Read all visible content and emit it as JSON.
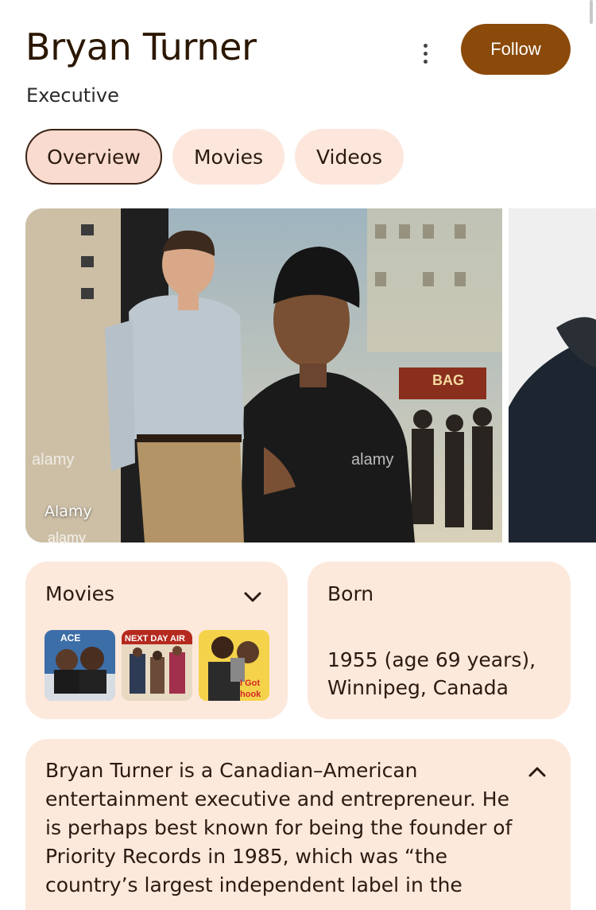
{
  "header": {
    "title": "Bryan Turner",
    "subtitle": "Executive",
    "more_icon": "more-vert-icon",
    "follow_label": "Follow"
  },
  "tabs": [
    {
      "label": "Overview",
      "active": true
    },
    {
      "label": "Movies",
      "active": false
    },
    {
      "label": "Videos",
      "active": false
    }
  ],
  "hero_image": {
    "credit": "Alamy",
    "watermark": "alamy",
    "poster_text": "BAG"
  },
  "movies_card": {
    "title": "Movies",
    "chevron_icon": "chevron-down-icon",
    "thumbnails": [
      {
        "alt": "movie-poster-1"
      },
      {
        "alt": "movie-poster-2",
        "text": "NEXT DAY AIR"
      },
      {
        "alt": "movie-poster-3",
        "text": "I Got the Hook"
      }
    ]
  },
  "born_card": {
    "title": "Born",
    "value": "1955 (age 69 years), Winnipeg, Canada"
  },
  "bio_card": {
    "text": "Bryan Turner is a Canadian–American entertainment executive and entrepreneur. He is perhaps best known for being the founder of Priority Records in 1985, which was “the country’s largest independent label in the",
    "chevron_icon": "chevron-up-icon"
  },
  "colors": {
    "accent": "#8b4a0a",
    "card_bg": "#fde8dc",
    "tab_bg": "#fde7dc",
    "title": "#2b1700"
  }
}
